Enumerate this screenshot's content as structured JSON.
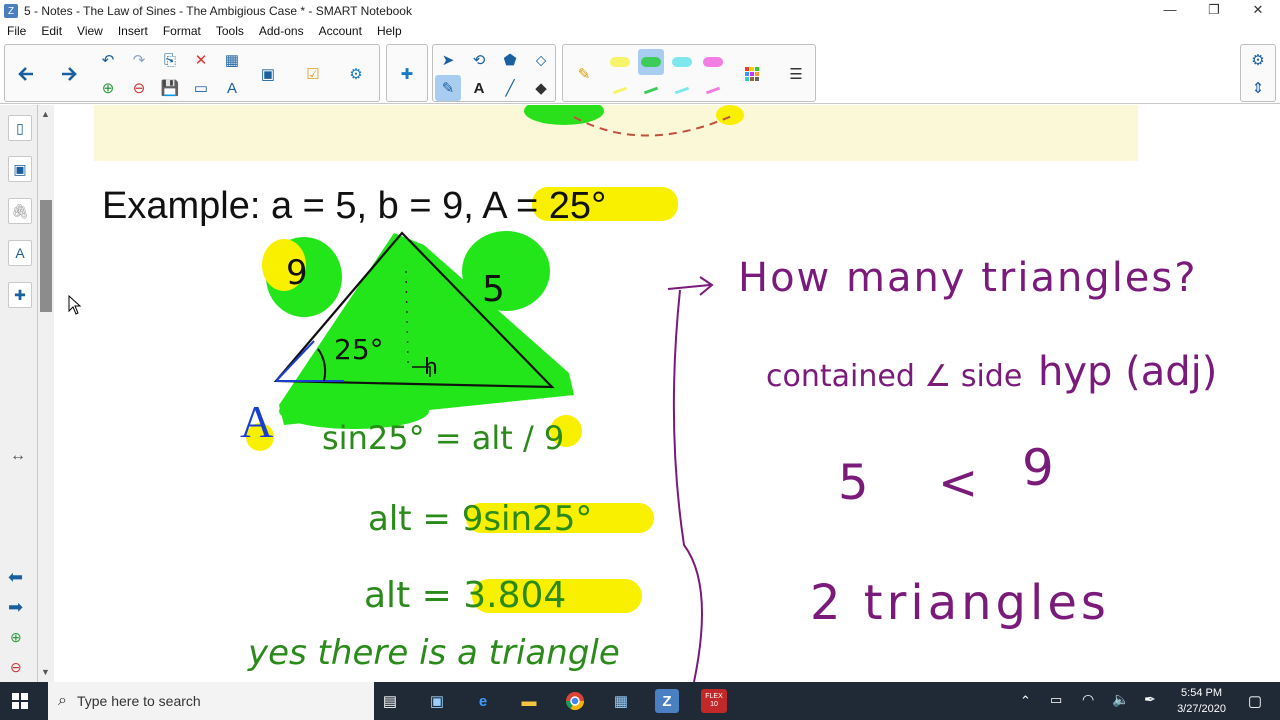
{
  "window": {
    "title": "5 - Notes - The Law of Sines - The Ambigious Case * - SMART Notebook"
  },
  "window_controls": {
    "minimize": "—",
    "restore": "❐",
    "close": "✕"
  },
  "menu": [
    "File",
    "Edit",
    "View",
    "Insert",
    "Format",
    "Tools",
    "Add-ons",
    "Account",
    "Help"
  ],
  "slide": {
    "example": "Example: a = 5, b = 9, A = 25°",
    "side_label_b": "9",
    "side_label_a": "5",
    "angle_label": "25°",
    "vertex_label": "A",
    "height_label": "h",
    "eq1": "sin25° = alt / 9",
    "eq2": "alt = 9sin25°",
    "eq3": "alt = 3.804",
    "eq4": "yes there is a triangle",
    "question": "How many triangles?",
    "condition": "contained ∠ side",
    "condition2": "hyp (adj)",
    "compare_left": "5",
    "compare_sign": "<",
    "compare_right": "9",
    "answer": "2 triangles"
  },
  "taskbar": {
    "search_placeholder": "Type here to search",
    "time": "5:54 PM",
    "date": "3/27/2020",
    "flex_label": "FLEX 10"
  },
  "colors": {
    "accent": "#1a5f9e",
    "highlight_green": "#22e51a",
    "highlight_yellow": "#f9f000",
    "ink_green": "#2a8a1a",
    "ink_purple": "#7a1a7a"
  }
}
